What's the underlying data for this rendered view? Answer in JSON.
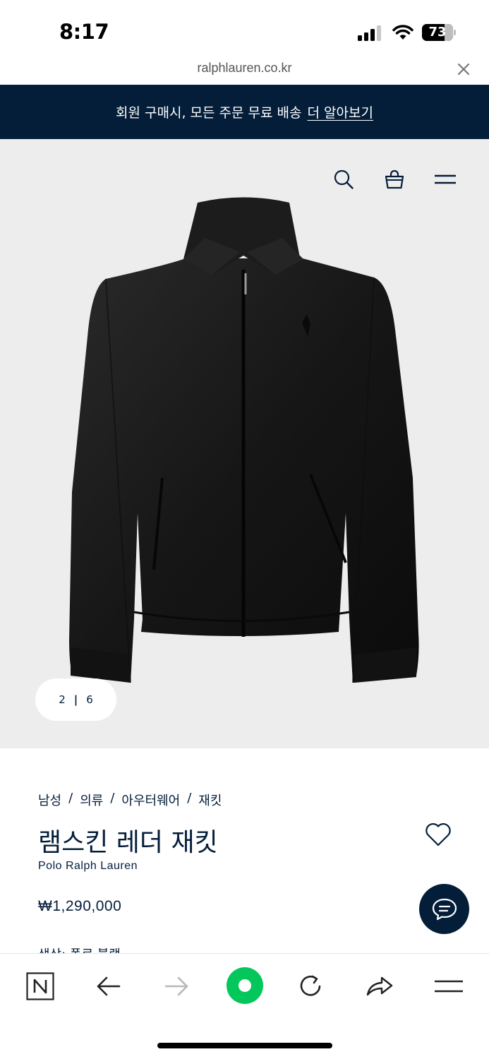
{
  "status_bar": {
    "time": "8:17",
    "battery": "73",
    "battery_level_percent": 73,
    "icons": [
      "cellular-signal-icon",
      "wifi-icon",
      "battery-icon"
    ]
  },
  "browser": {
    "url": "ralphlauren.co.kr",
    "close_icon": "close-icon"
  },
  "promo": {
    "text": "회원 구매시, 모든 주문 무료 배송",
    "link": "더 알아보기"
  },
  "header_icons": [
    "search-icon",
    "shopping-bag-icon",
    "menu-icon"
  ],
  "gallery": {
    "current": "2",
    "separator": "|",
    "total": "6"
  },
  "product": {
    "breadcrumb": [
      {
        "label": "남성"
      },
      {
        "label": "의류"
      },
      {
        "label": "아우터웨어"
      },
      {
        "label": "재킷"
      }
    ],
    "crumb_separator": "/",
    "title": "램스킨 레더 재킷",
    "brand": "Polo Ralph Lauren",
    "price": "₩1,290,000",
    "color_label_partial": "색상: 폴로 블랙"
  },
  "chat": {
    "icon": "chat-icon"
  },
  "browser_toolbar": {
    "items": [
      "naver-icon",
      "back-arrow-icon",
      "forward-arrow-icon",
      "green-circle-home-icon",
      "reload-icon",
      "share-icon",
      "menu-icon"
    ]
  },
  "colors": {
    "navy": "#041e3a",
    "hero_bg": "#eeedee",
    "green_button": "#03c75a"
  }
}
